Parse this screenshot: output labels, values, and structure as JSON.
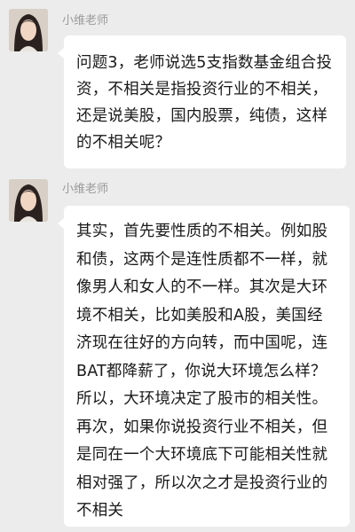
{
  "chat": {
    "messages": [
      {
        "sender": "小维老师",
        "text": "问题3，老师说选5支指数基金组合投资，不相关是指投资行业的不相关，还是说美股，国内股票，纯债，这样的不相关呢？"
      },
      {
        "sender": "小维老师",
        "text": "其实，首先要性质的不相关。例如股和债，这两个是连性质都不一样，就像男人和女人的不一样。其次是大环境不相关，比如美股和A股，美国经济现在往好的方向转，而中国呢，连BAT都降薪了，你说大环境怎么样？所以，大环境决定了股市的相关性。再次，如果你说投资行业不相关，但是同在一个大环境底下可能相关性就相对强了，所以次之才是投资行业的不相关"
      }
    ]
  },
  "colors": {
    "background": "#ececec",
    "bubble": "#ffffff",
    "sender_name": "#9a9a9a",
    "text": "#1a1a1a"
  },
  "icons": {
    "avatar": "user-avatar-photo"
  }
}
